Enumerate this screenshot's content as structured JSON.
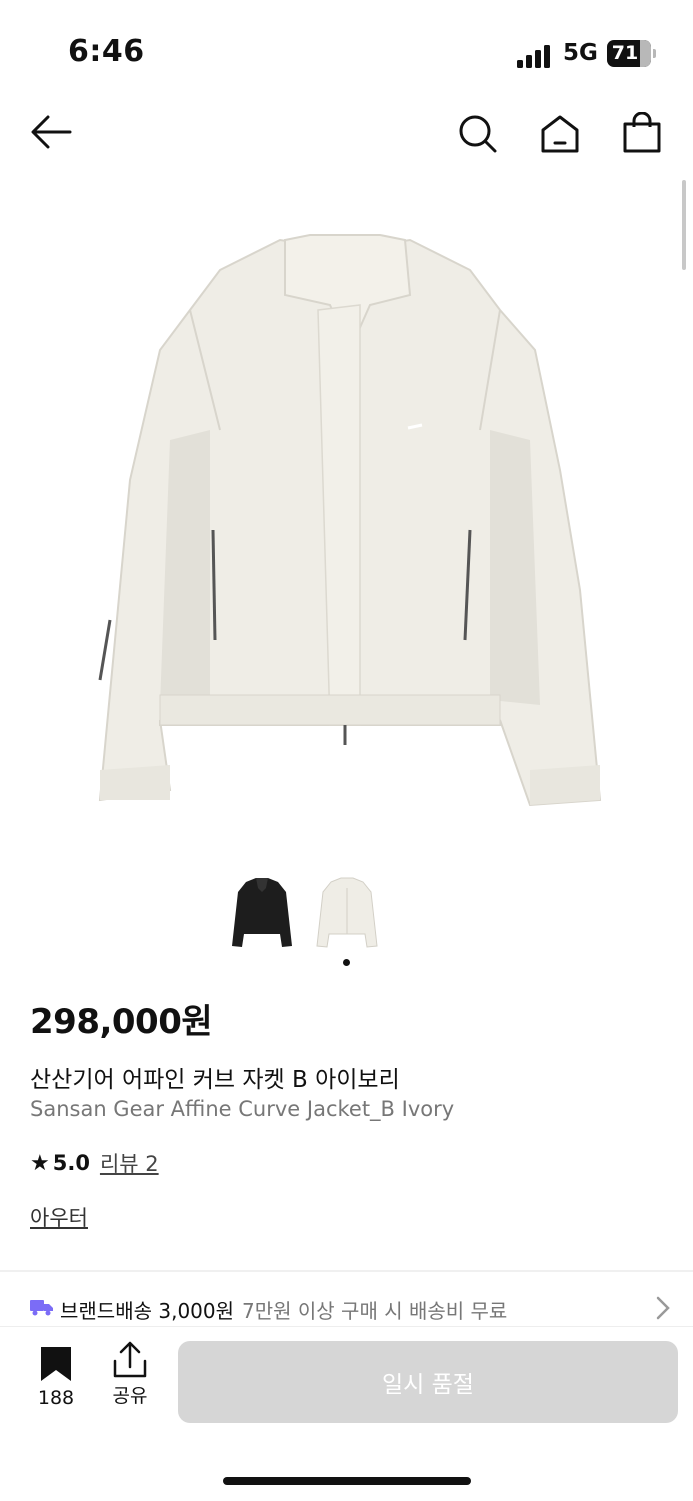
{
  "status_bar": {
    "time": "6:46",
    "network": "5G",
    "battery": "71"
  },
  "nav": {
    "back_icon": "arrow-left-icon",
    "search_icon": "search-icon",
    "home_icon": "home-icon",
    "cart_icon": "shopping-bag-icon"
  },
  "product": {
    "image_alt": "jacket-ivory",
    "thumbnails": [
      "black",
      "ivory"
    ],
    "selected_thumbnail": 1,
    "price": "298,000원",
    "name_ko": "산산기어 어파인 커브 자켓 B 아이보리",
    "name_en": "Sansan Gear Affine Curve Jacket_B Ivory",
    "rating": "5.0",
    "review_label": "리뷰 2",
    "category": "아우터"
  },
  "shipping": {
    "label": "브랜드배송 3,000원",
    "desc": "7만원 이상 구매 시 배송비 무료",
    "icon": "truck-icon",
    "chevron": "chevron-right-icon"
  },
  "bottom_bar": {
    "like_count": "188",
    "share_label": "공유",
    "soldout_label": "일시 품절"
  },
  "colors": {
    "accent": "#7b6cf6",
    "disabled": "#d6d6d6"
  }
}
